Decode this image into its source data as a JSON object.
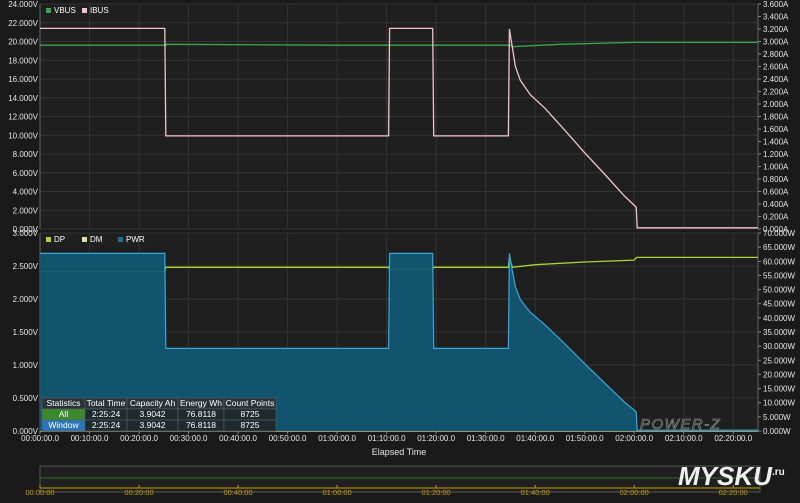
{
  "chart_data": [
    {
      "id": "top",
      "type": "line",
      "legend_position": "top-left",
      "grid": true,
      "left_axis": {
        "unit": "V",
        "ylim": [
          0,
          24
        ],
        "ticks": [
          "0.000V",
          "2.000V",
          "4.000V",
          "6.000V",
          "8.000V",
          "10.000V",
          "12.000V",
          "14.000V",
          "16.000V",
          "18.000V",
          "20.000V",
          "22.000V",
          "24.000V"
        ]
      },
      "right_axis": {
        "unit": "A",
        "ylim": [
          0,
          3.6
        ],
        "ticks": [
          "0.000A",
          "0.200A",
          "0.400A",
          "0.600A",
          "0.800A",
          "1.000A",
          "1.200A",
          "1.400A",
          "1.600A",
          "1.800A",
          "2.000A",
          "2.200A",
          "2.400A",
          "2.600A",
          "2.800A",
          "3.000A",
          "3.200A",
          "3.400A",
          "3.600A"
        ]
      },
      "series": [
        {
          "name": "VBUS",
          "axis": "left",
          "color": "#3aa84a",
          "x_min": [
            0,
            25.5,
            25.5,
            60,
            95,
            95.4,
            105,
            120,
            145
          ],
          "y": [
            19.6,
            19.6,
            19.7,
            19.6,
            19.6,
            19.45,
            19.7,
            19.9,
            19.9
          ]
        },
        {
          "name": "IBUS",
          "axis": "right",
          "color": "#f2c4cc",
          "x_min": [
            0,
            25.2,
            25.4,
            70.4,
            70.6,
            79.3,
            79.5,
            94.6,
            94.8,
            95.3,
            96,
            97,
            99,
            102,
            106,
            110,
            114,
            118,
            120.4,
            120.6,
            145
          ],
          "y": [
            3.21,
            3.21,
            1.49,
            1.49,
            3.21,
            3.21,
            1.49,
            1.49,
            3.2,
            2.95,
            2.6,
            2.38,
            2.15,
            1.93,
            1.58,
            1.22,
            0.88,
            0.53,
            0.35,
            0.02,
            0.02
          ]
        }
      ]
    },
    {
      "id": "bottom",
      "type": "area",
      "legend_position": "top-left",
      "grid": true,
      "xlabel": "Elapsed Time",
      "x_ticks": [
        "00:00:00.0",
        "00:10:00.0",
        "00:20:00.0",
        "00:30:00.0",
        "00:40:00.0",
        "00:50:00.0",
        "01:00:00.0",
        "01:10:00.0",
        "01:20:00.0",
        "01:30:00.0",
        "01:40:00.0",
        "01:50:00.0",
        "02:00:00.0",
        "02:10:00.0",
        "02:20:00.0"
      ],
      "left_axis": {
        "unit": "V",
        "ylim": [
          0,
          3
        ],
        "ticks": [
          "0.000V",
          "0.500V",
          "1.000V",
          "1.500V",
          "2.000V",
          "2.500V",
          "3.000V"
        ]
      },
      "right_axis": {
        "unit": "W",
        "ylim": [
          0,
          70
        ],
        "ticks": [
          "0.000W",
          "5.000W",
          "10.000W",
          "15.000W",
          "20.000W",
          "25.000W",
          "30.000W",
          "35.000W",
          "40.000W",
          "45.000W",
          "50.000W",
          "55.000W",
          "60.000W",
          "65.000W",
          "70.000W"
        ]
      },
      "series": [
        {
          "name": "DP",
          "axis": "left",
          "color": "#a8d836",
          "x_min": [
            0,
            25.2,
            25.4,
            70.4,
            70.6,
            79.3,
            79.5,
            94.6,
            94.8,
            95.4,
            100,
            110,
            120,
            120.5,
            145
          ],
          "y": [
            2.42,
            2.42,
            2.48,
            2.48,
            2.45,
            2.45,
            2.48,
            2.48,
            2.63,
            2.48,
            2.52,
            2.56,
            2.59,
            2.63,
            2.63
          ]
        },
        {
          "name": "DM",
          "axis": "left",
          "color": "#e8e0a0",
          "x_min": [
            0,
            145
          ],
          "y": [
            0,
            0
          ]
        },
        {
          "name": "PWR",
          "axis": "right",
          "color": "#1e6f94",
          "x_min": [
            0,
            25.2,
            25.4,
            70.4,
            70.6,
            79.3,
            79.5,
            94.6,
            94.8,
            95.3,
            96,
            97,
            99,
            102,
            106,
            110,
            114,
            118,
            120.4,
            120.6,
            145
          ],
          "y": [
            62.8,
            62.8,
            29.2,
            29.2,
            62.8,
            62.8,
            29.2,
            29.2,
            62.8,
            57.5,
            51,
            46.5,
            42,
            37.5,
            30.8,
            23.8,
            17,
            10.3,
            6.8,
            0.3,
            0.3
          ]
        }
      ]
    }
  ],
  "stats_table": {
    "headers": [
      "Statistics",
      "Total Time",
      "Capacity Ah",
      "Energy Wh",
      "Count Points"
    ],
    "rows": [
      [
        "All",
        "2:25:24",
        "3.9042",
        "76.8118",
        "8725"
      ],
      [
        "Window",
        "2:25:24",
        "3.9042",
        "76.8118",
        "8725"
      ]
    ]
  },
  "navigator": {
    "ticks": [
      "00:00:00",
      "00:20:00",
      "00:40:00",
      "01:00:00",
      "01:20:00",
      "01:40:00",
      "02:00:00",
      "02:20:00"
    ]
  },
  "watermark_brand": "POWER-Z",
  "site_watermark": {
    "text": "MYSKU",
    "suffix": ".ru"
  },
  "colors": {
    "background": "#1a1a1a",
    "plot_background": "#1f1f1f",
    "grid": "#333333",
    "navigator_tick": "#c8a000"
  }
}
